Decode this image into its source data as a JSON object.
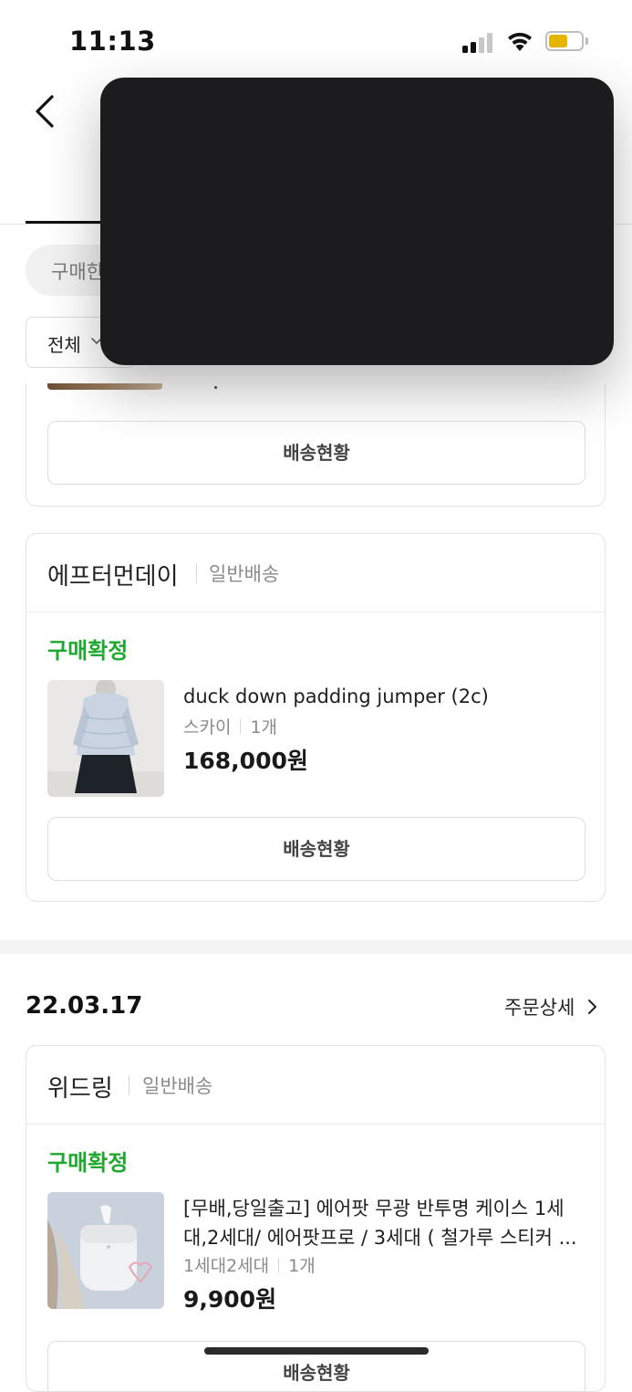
{
  "status_bar": {
    "time": "11:13",
    "signal_icon": "cellular-signal-icon",
    "wifi_icon": "wifi-icon",
    "battery_icon": "battery-icon",
    "battery_color": "#e6b500"
  },
  "header": {
    "back_icon": "chevron-left-icon"
  },
  "filters": {
    "chip_label": "구매한",
    "dropdown_label": "전체",
    "dropdown_icon": "chevron-down-icon"
  },
  "top_card": {
    "button_label": "배송현황"
  },
  "order_a": {
    "card": {
      "seller": "에프터먼데이",
      "shipping_type": "일반배송",
      "status": "구매확정",
      "status_color": "#1fa82f",
      "product": {
        "name": "duck down padding jumper (2c)",
        "option": "스카이",
        "quantity": "1개",
        "price": "168,000원"
      },
      "button_label": "배송현황"
    }
  },
  "order_b": {
    "date": "22.03.17",
    "detail_label": "주문상세",
    "detail_icon": "chevron-right-icon",
    "card": {
      "seller": "위드링",
      "shipping_type": "일반배송",
      "status": "구매확정",
      "status_color": "#1fa82f",
      "product": {
        "name": "[무배,당일출고] 에어팟 무광 반투명 케이스 1세대,2세대/ 에어팟프로 / 3세대 ( 철가루 스티커 ...",
        "option": "1세대2세대",
        "quantity": "1개",
        "price": "9,900원"
      },
      "button_label": "배송현황"
    }
  }
}
